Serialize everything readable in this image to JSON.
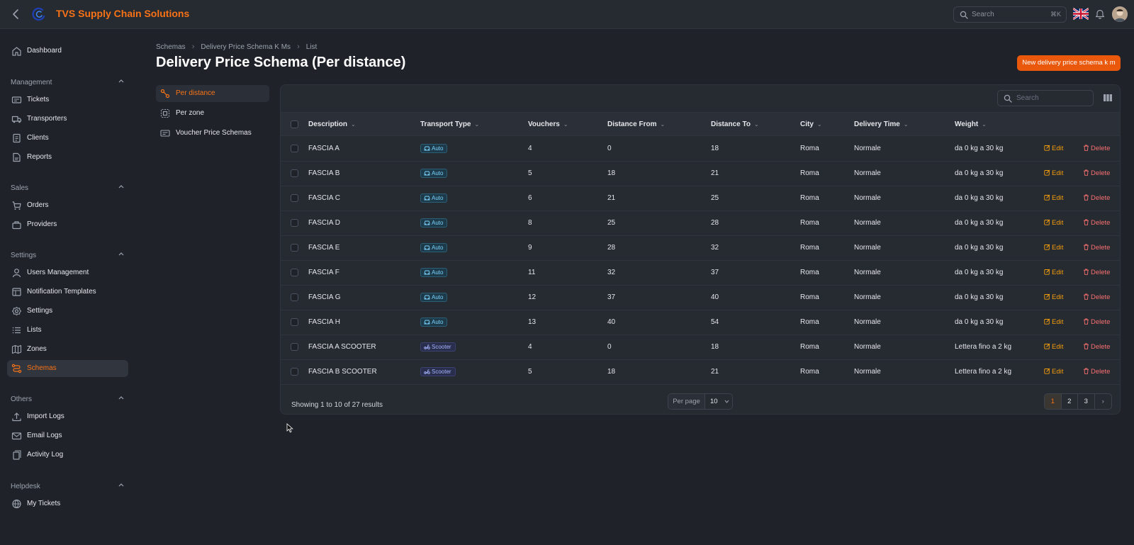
{
  "app": {
    "title": "TVS Supply Chain Solutions"
  },
  "topbar": {
    "search_placeholder": "Search",
    "search_shortcut": "⌘K"
  },
  "sidebar": {
    "dashboard": "Dashboard",
    "groups": [
      {
        "label": "Management",
        "items": [
          "Tickets",
          "Transporters",
          "Clients",
          "Reports"
        ]
      },
      {
        "label": "Sales",
        "items": [
          "Orders",
          "Providers"
        ]
      },
      {
        "label": "Settings",
        "items": [
          "Users Management",
          "Notification Templates",
          "Settings",
          "Lists",
          "Zones",
          "Schemas"
        ]
      },
      {
        "label": "Others",
        "items": [
          "Import Logs",
          "Email Logs",
          "Activity Log"
        ]
      },
      {
        "label": "Helpdesk",
        "items": [
          "My Tickets"
        ]
      }
    ],
    "active": "Schemas"
  },
  "breadcrumb": [
    "Schemas",
    "Delivery Price Schema K Ms",
    "List"
  ],
  "page": {
    "title": "Delivery Price Schema (Per distance)",
    "new_button": "New delivery price schema k m"
  },
  "subnav": [
    "Per distance",
    "Per zone",
    "Voucher Price Schemas"
  ],
  "table": {
    "search_placeholder": "Search",
    "columns": [
      "Description",
      "Transport Type",
      "Vouchers",
      "Distance From",
      "Distance To",
      "City",
      "Delivery Time",
      "Weight"
    ],
    "rows": [
      {
        "description": "FASCIA A",
        "transport": "Auto",
        "vouchers": "4",
        "from": "0",
        "to": "18",
        "city": "Roma",
        "delivery": "Normale",
        "weight": "da 0 kg a 30 kg"
      },
      {
        "description": "FASCIA B",
        "transport": "Auto",
        "vouchers": "5",
        "from": "18",
        "to": "21",
        "city": "Roma",
        "delivery": "Normale",
        "weight": "da 0 kg a 30 kg"
      },
      {
        "description": "FASCIA C",
        "transport": "Auto",
        "vouchers": "6",
        "from": "21",
        "to": "25",
        "city": "Roma",
        "delivery": "Normale",
        "weight": "da 0 kg a 30 kg"
      },
      {
        "description": "FASCIA D",
        "transport": "Auto",
        "vouchers": "8",
        "from": "25",
        "to": "28",
        "city": "Roma",
        "delivery": "Normale",
        "weight": "da 0 kg a 30 kg"
      },
      {
        "description": "FASCIA E",
        "transport": "Auto",
        "vouchers": "9",
        "from": "28",
        "to": "32",
        "city": "Roma",
        "delivery": "Normale",
        "weight": "da 0 kg a 30 kg"
      },
      {
        "description": "FASCIA F",
        "transport": "Auto",
        "vouchers": "11",
        "from": "32",
        "to": "37",
        "city": "Roma",
        "delivery": "Normale",
        "weight": "da 0 kg a 30 kg"
      },
      {
        "description": "FASCIA G",
        "transport": "Auto",
        "vouchers": "12",
        "from": "37",
        "to": "40",
        "city": "Roma",
        "delivery": "Normale",
        "weight": "da 0 kg a 30 kg"
      },
      {
        "description": "FASCIA H",
        "transport": "Auto",
        "vouchers": "13",
        "from": "40",
        "to": "54",
        "city": "Roma",
        "delivery": "Normale",
        "weight": "da 0 kg a 30 kg"
      },
      {
        "description": "FASCIA A SCOOTER",
        "transport": "Scooter",
        "vouchers": "4",
        "from": "0",
        "to": "18",
        "city": "Roma",
        "delivery": "Normale",
        "weight": "Lettera fino a 2 kg"
      },
      {
        "description": "FASCIA B SCOOTER",
        "transport": "Scooter",
        "vouchers": "5",
        "from": "18",
        "to": "21",
        "city": "Roma",
        "delivery": "Normale",
        "weight": "Lettera fino a 2 kg"
      }
    ],
    "actions": {
      "edit": "Edit",
      "delete": "Delete"
    },
    "footer": {
      "summary": "Showing 1 to 10 of 27 results",
      "per_page_label": "Per page",
      "per_page_value": "10",
      "pages": [
        "1",
        "2",
        "3"
      ],
      "current_page": "1"
    }
  },
  "colors": {
    "accent": "#f97316",
    "primary_button": "#ea580c",
    "background": "#1f2329",
    "panel": "#262a31"
  }
}
